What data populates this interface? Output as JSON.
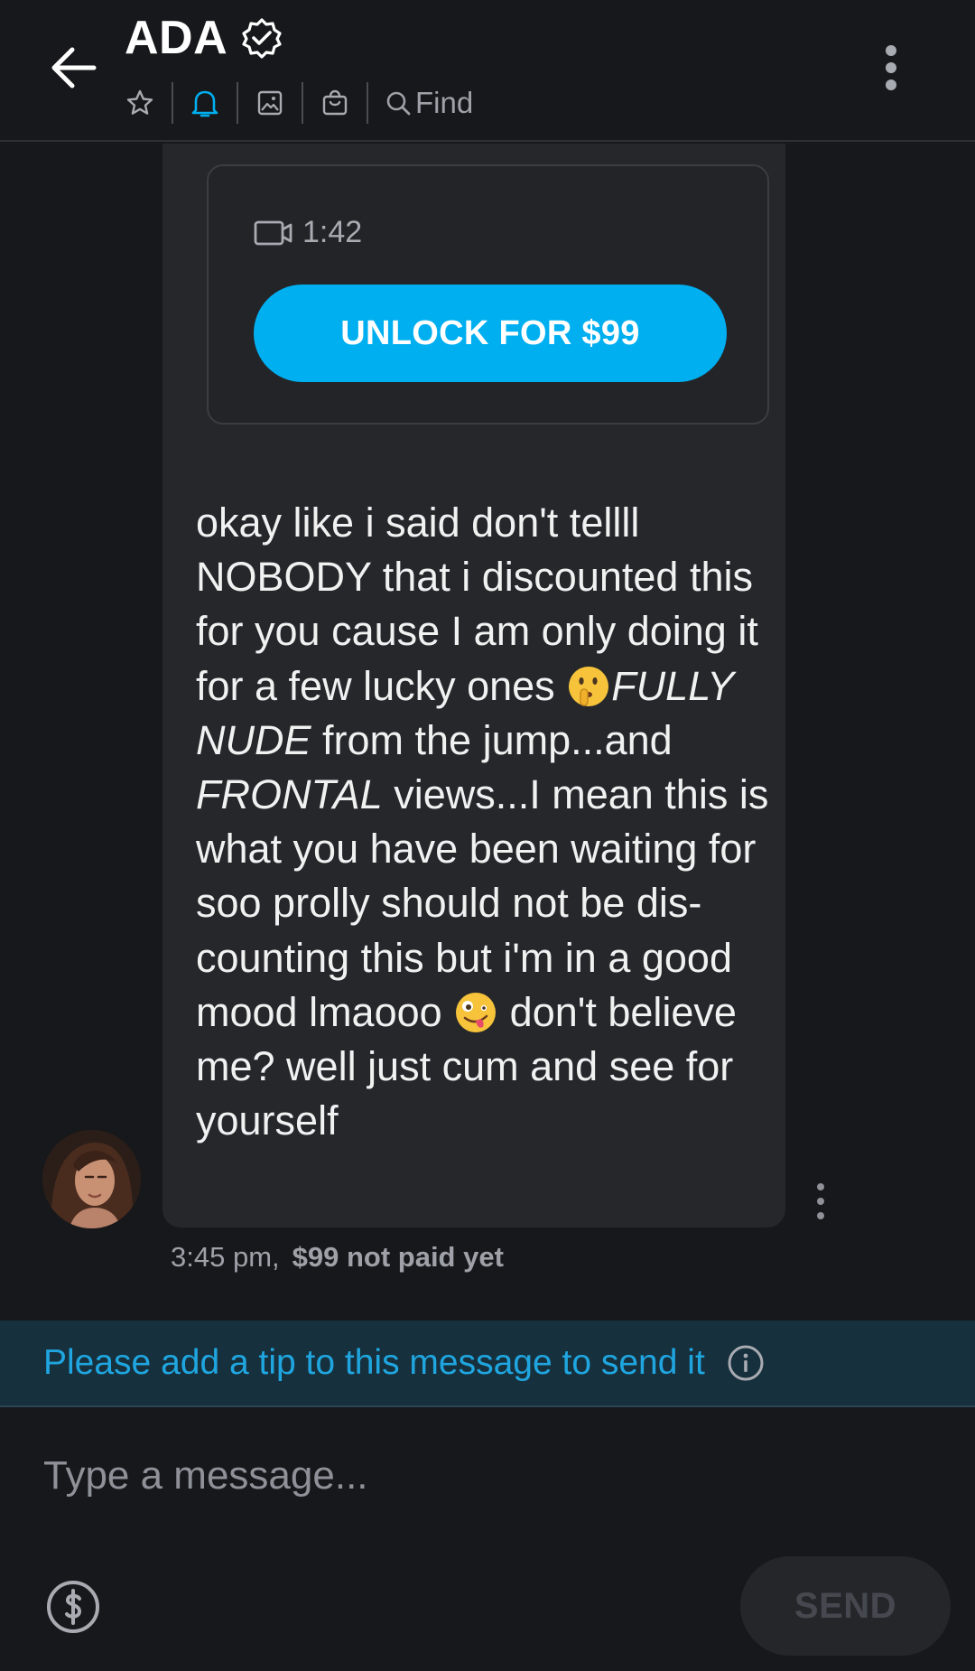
{
  "header": {
    "title": "ADA",
    "toolbar": {
      "find_label": "Find"
    }
  },
  "message": {
    "media": {
      "duration": "1:42",
      "unlock_label": "UNLOCK FOR $99"
    },
    "text": {
      "p1": "okay like i said don't tellll NOBODY that i discounted this for you cause I am only doing it for a few lucky ones ",
      "emoji1": "shushing-face",
      "p2_em": "FULLY NUDE",
      "p3": " from the jump...and ",
      "p4_em": "FRONTAL",
      "p5": " views...I mean this is what you have been waiting for soo prolly should not be dis-counting this but i'm in a good mood lmaooo ",
      "emoji2": "zany-face",
      "p6": " don't believe me? well just cum and see for yourself"
    },
    "time": "3:45 pm,",
    "price_status": "$99 not paid yet"
  },
  "tip_notice": {
    "text": "Please add a tip to this message to send it"
  },
  "composer": {
    "placeholder": "Type a message...",
    "send_label": "SEND"
  },
  "colors": {
    "accent": "#00aff0",
    "background": "#17181b",
    "bubble": "#25272b",
    "tip_bar": "#17303d"
  }
}
